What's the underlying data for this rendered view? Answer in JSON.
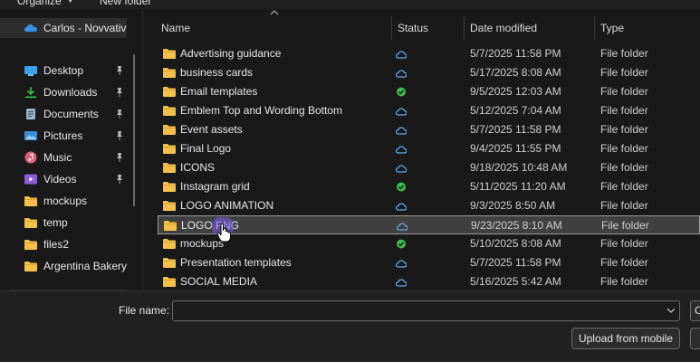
{
  "toolbar": {
    "organize_label": "Organize",
    "new_folder_label": "New folder"
  },
  "nav": {
    "onedrive_label": "Carlos - Novvativ",
    "items": [
      {
        "label": "Desktop",
        "icon": "desktop-icon",
        "pinned": true
      },
      {
        "label": "Downloads",
        "icon": "download-icon",
        "pinned": true
      },
      {
        "label": "Documents",
        "icon": "documents-icon",
        "pinned": true
      },
      {
        "label": "Pictures",
        "icon": "pictures-icon",
        "pinned": true
      },
      {
        "label": "Music",
        "icon": "music-icon",
        "pinned": true
      },
      {
        "label": "Videos",
        "icon": "videos-icon",
        "pinned": true
      },
      {
        "label": "mockups",
        "icon": "folder-icon",
        "pinned": false
      },
      {
        "label": "temp",
        "icon": "folder-icon",
        "pinned": false
      },
      {
        "label": "files2",
        "icon": "folder-icon",
        "pinned": false
      },
      {
        "label": "Argentina Bakery",
        "icon": "folder-icon",
        "pinned": false
      }
    ]
  },
  "columns": {
    "name": "Name",
    "status": "Status",
    "date": "Date modified",
    "type": "Type"
  },
  "files": [
    {
      "name": "Advertising guidance",
      "status": "cloud",
      "date": "5/7/2025 11:58 PM",
      "type": "File folder"
    },
    {
      "name": "business cards",
      "status": "cloud",
      "date": "5/17/2025 8:08 AM",
      "type": "File folder"
    },
    {
      "name": "Email templates",
      "status": "synced",
      "date": "9/5/2025 12:03 AM",
      "type": "File folder"
    },
    {
      "name": "Emblem Top and Wording Bottom",
      "status": "cloud",
      "date": "5/12/2025 7:04 AM",
      "type": "File folder"
    },
    {
      "name": "Event assets",
      "status": "cloud",
      "date": "5/7/2025 11:58 PM",
      "type": "File folder"
    },
    {
      "name": "Final Logo",
      "status": "cloud",
      "date": "9/4/2025 11:55 PM",
      "type": "File folder"
    },
    {
      "name": "ICONS",
      "status": "cloud",
      "date": "9/18/2025 10:48 AM",
      "type": "File folder"
    },
    {
      "name": "Instagram grid",
      "status": "synced",
      "date": "5/11/2025 11:20 AM",
      "type": "File folder"
    },
    {
      "name": "LOGO ANIMATION",
      "status": "cloud",
      "date": "9/3/2025 8:50 AM",
      "type": "File folder"
    },
    {
      "name": "LOGO PNG",
      "status": "cloud",
      "date": "9/23/2025 8:10 AM",
      "type": "File folder",
      "selected": true
    },
    {
      "name": "mockups",
      "status": "synced",
      "date": "5/10/2025 8:08 AM",
      "type": "File folder"
    },
    {
      "name": "Presentation templates",
      "status": "cloud",
      "date": "5/7/2025 11:58 PM",
      "type": "File folder"
    },
    {
      "name": "SOCIAL MEDIA",
      "status": "cloud",
      "date": "5/16/2025 5:42 AM",
      "type": "File folder"
    }
  ],
  "bottom": {
    "file_name_label": "File name:",
    "file_name_value": "",
    "upload_label": "Upload from mobile",
    "edge_label": "C"
  },
  "colors": {
    "folder": "#f3c14b",
    "cloud_status": "#6aa8e0",
    "synced_status": "#3fb94f",
    "onedrive": "#3b8fe6"
  }
}
